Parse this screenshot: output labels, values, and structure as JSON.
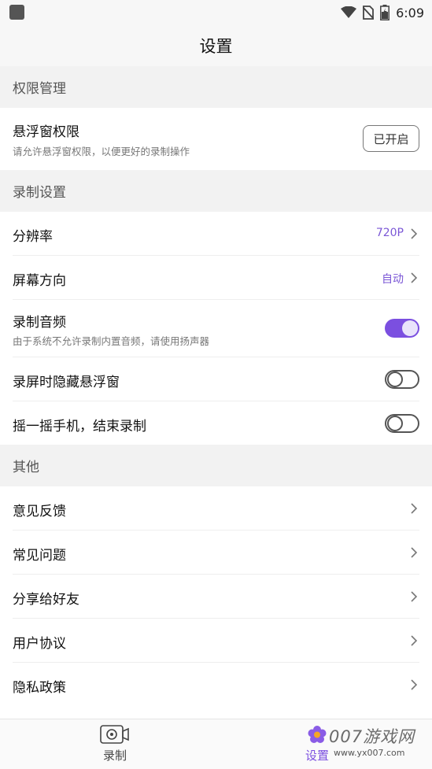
{
  "status_bar": {
    "time": "6:09"
  },
  "header": {
    "title": "设置"
  },
  "sections": {
    "permissions": {
      "title": "权限管理",
      "float_window": {
        "title": "悬浮窗权限",
        "subtitle": "请允许悬浮窗权限，以便更好的录制操作",
        "button": "已开启"
      }
    },
    "recording": {
      "title": "录制设置",
      "resolution": {
        "title": "分辨率",
        "value": "720P"
      },
      "orientation": {
        "title": "屏幕方向",
        "value": "自动"
      },
      "audio": {
        "title": "录制音频",
        "subtitle": "由于系统不允许录制内置音频，请使用扬声器",
        "enabled": true
      },
      "hide_float": {
        "title": "录屏时隐藏悬浮窗",
        "enabled": false
      },
      "shake_stop": {
        "title": "摇一摇手机，结束录制",
        "enabled": false
      }
    },
    "other": {
      "title": "其他",
      "items": [
        {
          "title": "意见反馈"
        },
        {
          "title": "常见问题"
        },
        {
          "title": "分享给好友"
        },
        {
          "title": "用户协议"
        },
        {
          "title": "隐私政策"
        }
      ]
    }
  },
  "tabs": [
    {
      "label": "录制",
      "icon": "camera-icon",
      "active": false
    },
    {
      "label": "设置",
      "icon": "flower-settings-icon",
      "active": true
    }
  ],
  "watermark": {
    "main": "007游戏网",
    "sub": "www.yx007.com"
  },
  "colors": {
    "accent": "#7b4fe0",
    "value_text": "#7b57d6"
  }
}
